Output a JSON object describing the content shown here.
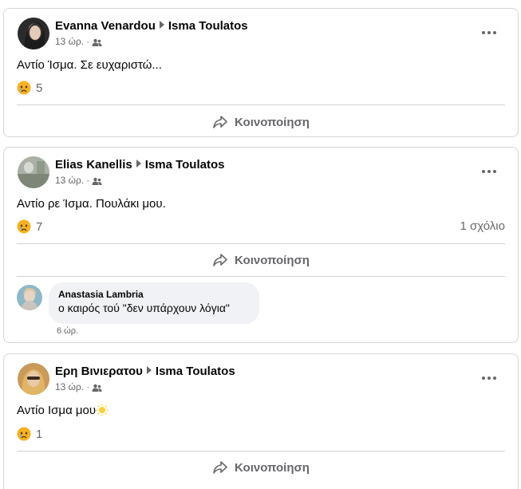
{
  "posts": [
    {
      "author": "Evanna Venardou",
      "target": "Isma Toulatos",
      "time": "13 ώρ.",
      "text": "Αντίο Ίσμα. Σε ευχαριστώ...",
      "reaction_count": "5",
      "share_label": "Κοινοποίηση"
    },
    {
      "author": "Elias Kanellis",
      "target": "Isma Toulatos",
      "time": "13 ώρ.",
      "text": "Αντίο ρε Ίσμα. Πουλάκι μου.",
      "reaction_count": "7",
      "comments_label": "1 σχόλιο",
      "share_label": "Κοινοποίηση",
      "comment": {
        "author": "Anastasia Lambria",
        "text": "ο καιρός τού \"δεν υπάρχουν λόγια\"",
        "time": "6 ώρ."
      }
    },
    {
      "author": "Ερη Βινιερατου",
      "target": "Isma Toulatos",
      "time": "13 ώρ.",
      "text": "Αντίο Ισμα μου",
      "reaction_count": "1",
      "share_label": "Κοινοποίηση"
    }
  ],
  "icons": {
    "reaction": "sad-face-icon",
    "audience": "friends-icon",
    "share": "share-arrow-icon",
    "more": "more-options-icon",
    "emoji_in_text": "sun-emoji-icon"
  },
  "colors": {
    "secondary_text": "#65676b",
    "divider": "#ced0d4",
    "bubble": "#f0f2f5",
    "reaction_yellow": "#f7b125"
  }
}
